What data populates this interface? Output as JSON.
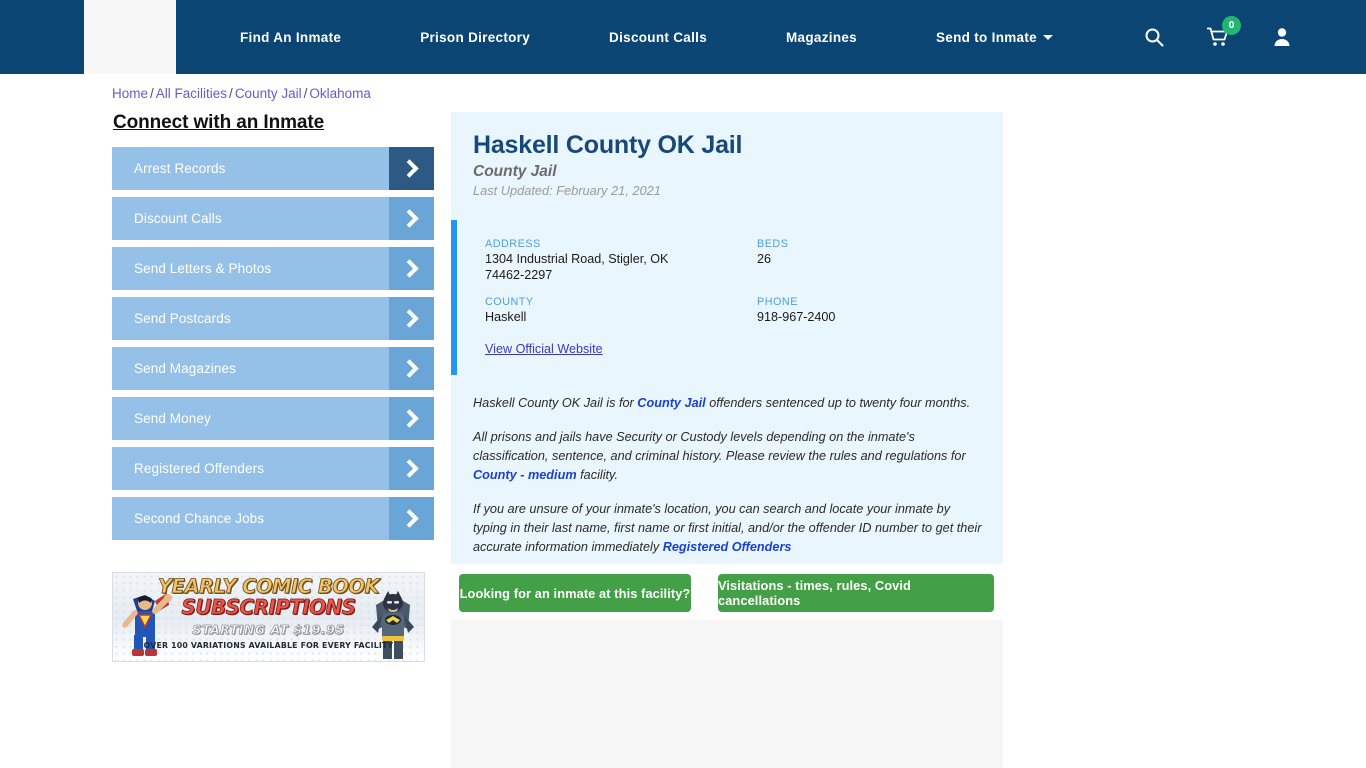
{
  "nav": {
    "logo_alt": "site-logo",
    "links": [
      {
        "label": "Find An Inmate"
      },
      {
        "label": "Prison Directory"
      },
      {
        "label": "Discount Calls"
      },
      {
        "label": "Magazines"
      },
      {
        "label": "Send to Inmate"
      }
    ],
    "icons": {
      "search": "search-icon",
      "cart": "cart-icon",
      "cart_count": "0",
      "account": "user-icon"
    },
    "colors": {
      "bar": "#0b4574",
      "badge": "#22b573"
    }
  },
  "breadcrumb": {
    "items": [
      {
        "label": "Home"
      },
      {
        "label": "All Facilities"
      },
      {
        "label": "County Jail"
      },
      {
        "label": "Oklahoma"
      }
    ],
    "separator": "/"
  },
  "sidebar": {
    "heading": "Connect with an Inmate",
    "items": [
      {
        "label": "Arrest Records"
      },
      {
        "label": "Discount Calls"
      },
      {
        "label": "Send Letters & Photos"
      },
      {
        "label": "Send Postcards"
      },
      {
        "label": "Send Magazines"
      },
      {
        "label": "Send Money"
      },
      {
        "label": "Registered Offenders"
      },
      {
        "label": "Second Chance Jobs"
      }
    ]
  },
  "ad": {
    "title_line1": "YEARLY COMIC BOOK",
    "title_line2": "SUBSCRIPTIONS",
    "subtitle": "STARTING AT $19.95",
    "footer": "OVER 100 VARIATIONS AVAILABLE FOR EVERY FACILITY"
  },
  "facility": {
    "name": "Haskell County OK Jail",
    "type": "County Jail",
    "last_updated": "Last Updated: February 21, 2021",
    "fields": {
      "address_label": "ADDRESS",
      "address_value": "1304 Industrial Road, Stigler, OK 74462-2297",
      "beds_label": "BEDS",
      "beds_value": "26",
      "county_label": "COUNTY",
      "county_value": "Haskell",
      "phone_label": "PHONE",
      "phone_value": "918-967-2400"
    },
    "official_website_link": "View Official Website",
    "accent_color": "#2196f3"
  },
  "description": {
    "p1_a": "Haskell County OK Jail is for ",
    "p1_link": "County Jail",
    "p1_b": " offenders sentenced up to twenty four months.",
    "p2_a": "All prisons and jails have Security or Custody levels depending on the inmate's classification, sentence, and criminal history. Please review the rules and regulations for ",
    "p2_link": "County - medium",
    "p2_b": " facility.",
    "p3_a": "If you are unsure of your inmate's location, you can search and locate your inmate by typing in their last name, first name or first initial, and/or the offender ID number to get their accurate information immediately ",
    "p3_link": "Registered Offenders"
  },
  "actions": {
    "inmate_search_label": "Looking for an inmate at this facility?",
    "visitations_label": "Visitations - times, rules, Covid cancellations",
    "button_color": "#43a047"
  }
}
